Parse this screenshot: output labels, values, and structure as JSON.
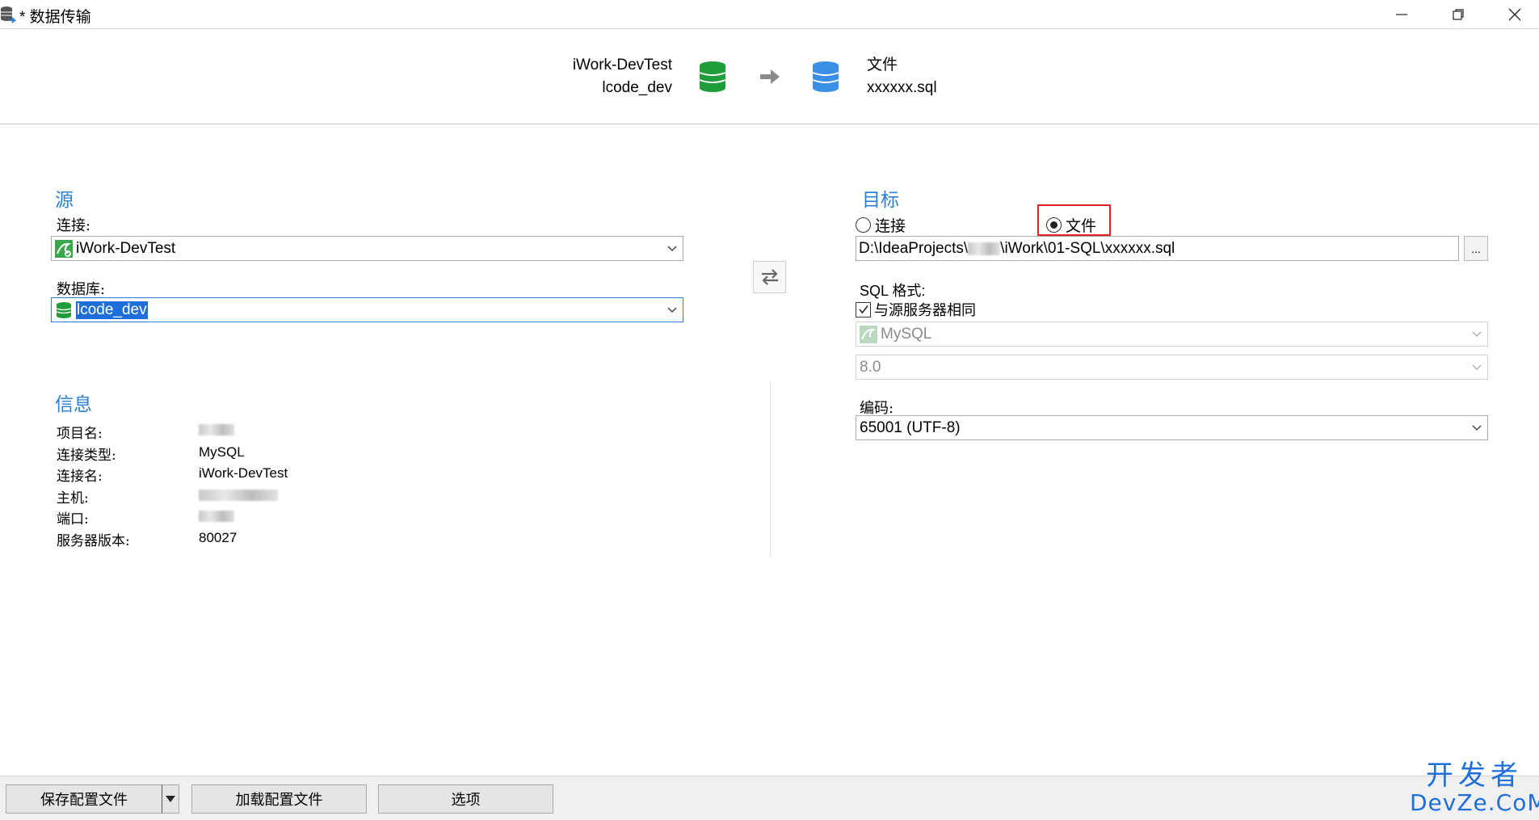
{
  "window": {
    "title": "* 数据传输"
  },
  "header": {
    "source_connection": "iWork-DevTest",
    "source_database": "lcode_dev",
    "target_type": "文件",
    "target_file": "xxxxxx.sql"
  },
  "source": {
    "heading": "源",
    "connection_label": "连接:",
    "connection_value": "iWork-DevTest",
    "database_label": "数据库:",
    "database_value": "lcode_dev"
  },
  "info": {
    "heading": "信息",
    "rows": [
      {
        "label": "项目名:",
        "value": ""
      },
      {
        "label": "连接类型:",
        "value": "MySQL"
      },
      {
        "label": "连接名:",
        "value": "iWork-DevTest"
      },
      {
        "label": "主机:",
        "value": ""
      },
      {
        "label": "端口:",
        "value": ""
      },
      {
        "label": "服务器版本:",
        "value": "80027"
      }
    ]
  },
  "target": {
    "heading": "目标",
    "radio_connection": "连接",
    "radio_file": "文件",
    "selected": "file",
    "path_part1": "D:\\IdeaProjects\\",
    "path_part2": "\\iWork\\01-SQL\\xxxxxx.sql",
    "browse_label": "...",
    "sql_format_label": "SQL 格式:",
    "same_as_source_label": "与源服务器相同",
    "same_as_source_checked": true,
    "server_type": "MySQL",
    "server_version": "8.0",
    "encoding_label": "编码:",
    "encoding_value": "65001 (UTF-8)"
  },
  "footer": {
    "save_config": "保存配置文件",
    "load_config": "加载配置文件",
    "options": "选项"
  },
  "watermark": {
    "line1": "开发者",
    "line2": "DevZe.CoM"
  },
  "colors": {
    "accent": "#2a7fd4",
    "source_db": "#1f9d3a",
    "target_db": "#3b8fe6",
    "highlight_box": "#e02020"
  }
}
